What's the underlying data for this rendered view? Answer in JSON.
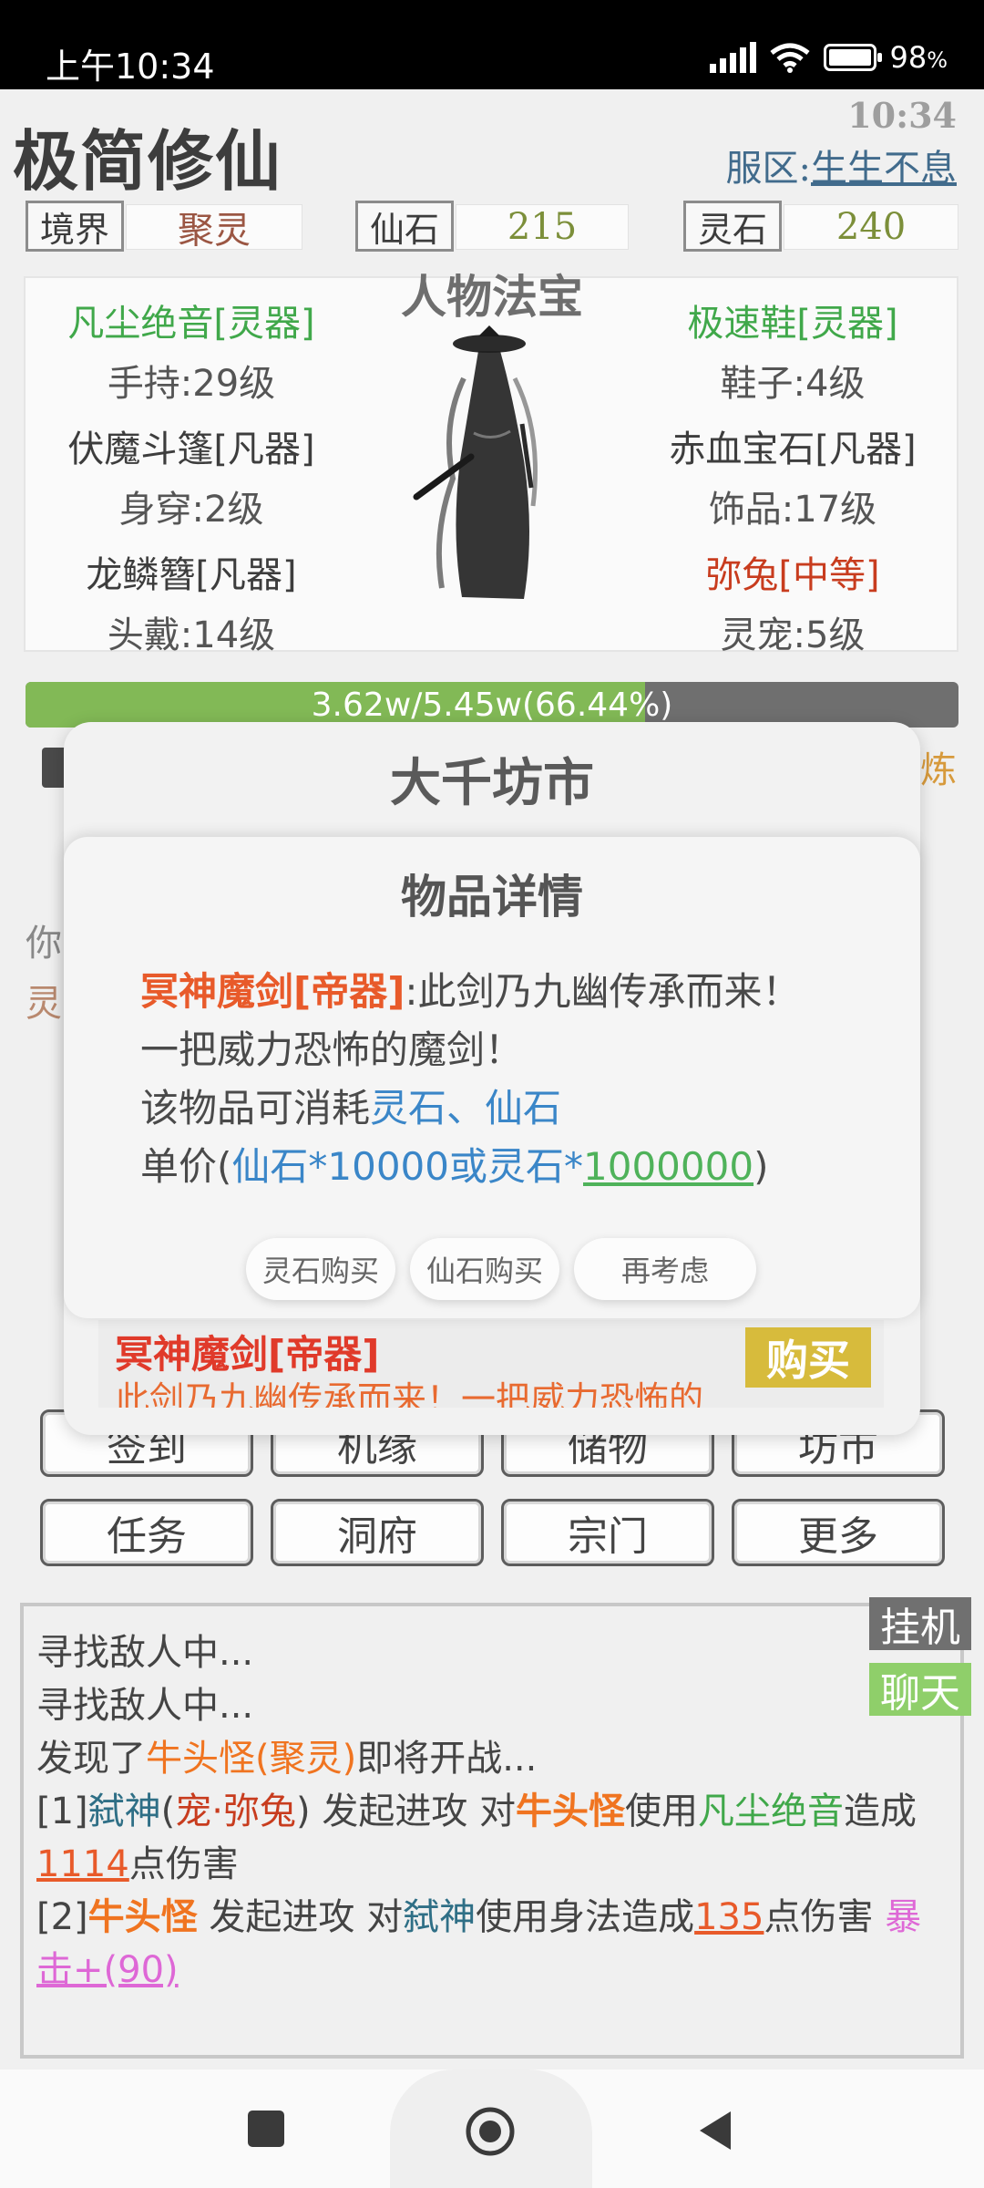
{
  "status_bar": {
    "time": "上午10:34",
    "battery": "98"
  },
  "header": {
    "game_title": "极简修仙",
    "clock": "10:34",
    "server_label": "服区:",
    "server_name": "生生不息"
  },
  "stats": [
    {
      "label": "境界",
      "value": "聚灵",
      "color": "#9b5643"
    },
    {
      "label": "仙石",
      "value": "215",
      "color": "#7c8f3a"
    },
    {
      "label": "灵石",
      "value": "240",
      "color": "#7c8f3a"
    }
  ],
  "equipment": {
    "title": "人物法宝",
    "left": [
      {
        "name": "凡尘绝音[灵器]",
        "slot": "手持:29级",
        "color": "#40a84a"
      },
      {
        "name": "伏魔斗篷[凡器]",
        "slot": "身穿:2级",
        "color": "#3d3d3d"
      },
      {
        "name": "龙鳞簪[凡器]",
        "slot": "头戴:14级",
        "color": "#3d3d3d"
      }
    ],
    "right": [
      {
        "name": "极速鞋[灵器]",
        "slot": "鞋子:4级",
        "color": "#40a84a"
      },
      {
        "name": "赤血宝石[凡器]",
        "slot": "饰品:17级",
        "color": "#3d3d3d"
      },
      {
        "name": "弥兔[中等]",
        "slot": "灵宠:5级",
        "color": "#c83c1e"
      }
    ]
  },
  "progress": {
    "text": "3.62w/5.45w(66.44%)",
    "fraction": 0.6644
  },
  "market": {
    "title": "大千坊市",
    "item_dialog": {
      "title": "物品详情",
      "item_name": "冥神魔剑[帝器]",
      "desc_line1": ":此剑乃九幽传承而来！",
      "desc_line2": "一把威力恐怖的魔剑！",
      "consume_prefix": "该物品可消耗",
      "consume_currencies": "灵石、仙石",
      "price_prefix": "单价(",
      "price_xianshi": "仙石*10000或灵石*",
      "price_lingshi_amount": "1000000",
      "price_suffix": ")",
      "buttons": {
        "buy_lingshi": "灵石购买",
        "buy_xianshi": "仙石购买",
        "reconsider": "再考虑"
      }
    },
    "listing": {
      "name": "冥神魔剑[帝器]",
      "desc": "此剑乃九幽传承而来！一把威力恐怖的",
      "buy_label": "购买"
    }
  },
  "menu_buttons": {
    "row1": [
      "签到",
      "机缘",
      "储物",
      "坊市"
    ],
    "row2": [
      "任务",
      "洞府",
      "宗门",
      "更多"
    ]
  },
  "log": {
    "auto_label": "挂机",
    "chat_label": "聊天",
    "line1": "寻找敌人中...",
    "line2": "寻找敌人中...",
    "line3": {
      "prefix": "发现了",
      "enemy": "牛头怪(聚灵)",
      "suffix": "即将开战..."
    },
    "line4": {
      "idx": "[1]",
      "player": "弑神",
      "pet_open": "(",
      "pet": "宠·弥兔",
      "pet_close": ")",
      "mid": " 发起进攻 对",
      "enemy": "牛头怪",
      "use": "使用",
      "skill": "凡尘绝音",
      "tail": "造成"
    },
    "line5": {
      "damage": "1114",
      "tail": "点伤害"
    },
    "line6": {
      "idx": "[2]",
      "enemy": "牛头怪",
      "mid": " 发起进攻 对",
      "player": "弑神",
      "skill_use": "使用身法造成",
      "damage": "135",
      "tail": "点伤害 ",
      "crit": "暴"
    },
    "line7": {
      "crit_tail": "击+(90)"
    }
  },
  "colors": {
    "accent_green": "#82b956",
    "buy_gold": "#d7bb3c",
    "chat_green": "#8fcf6a"
  }
}
